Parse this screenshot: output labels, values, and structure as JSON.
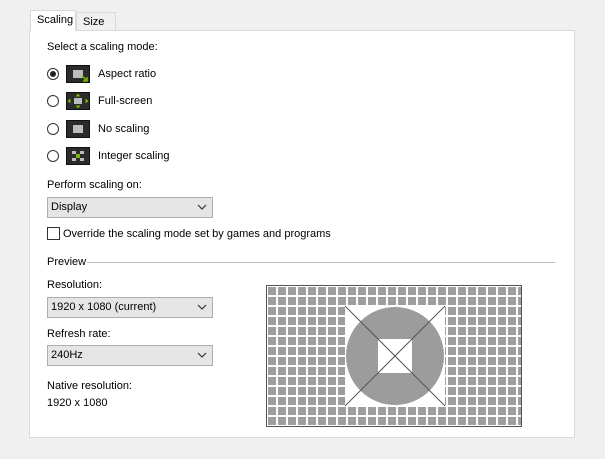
{
  "tabs": [
    {
      "label": "Scaling",
      "active": true
    },
    {
      "label": "Size",
      "active": false
    }
  ],
  "scaling_mode": {
    "heading": "Select a scaling mode:",
    "options": [
      {
        "label": "Aspect ratio",
        "icon": "aspect-ratio-icon",
        "checked": true
      },
      {
        "label": "Full-screen",
        "icon": "full-screen-icon",
        "checked": false
      },
      {
        "label": "No scaling",
        "icon": "no-scaling-icon",
        "checked": false
      },
      {
        "label": "Integer scaling",
        "icon": "integer-scaling-icon",
        "checked": false
      }
    ]
  },
  "perform_scaling": {
    "label": "Perform scaling on:",
    "value": "Display"
  },
  "override": {
    "label": "Override the scaling mode set by games and programs",
    "checked": false
  },
  "preview": {
    "heading": "Preview",
    "resolution_label": "Resolution:",
    "resolution_value": "1920 x 1080 (current)",
    "refresh_label": "Refresh rate:",
    "refresh_value": "240Hz",
    "native_label": "Native resolution:",
    "native_value": "1920 x 1080"
  },
  "colors": {
    "accent_green": "#76b900",
    "grid_gray": "#9e9e9e",
    "circle_gray": "#9c9c9c"
  }
}
